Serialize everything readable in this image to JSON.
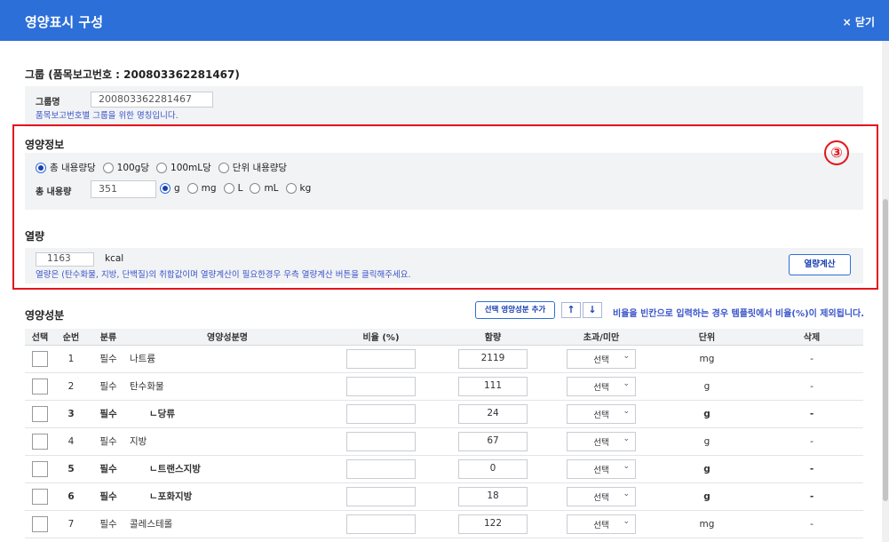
{
  "header": {
    "title": "영양표시 구성",
    "close_label": "닫기",
    "close_icon": "×"
  },
  "group": {
    "title": "그룹 (품목보고번호 : 200803362281467)",
    "name_label": "그룹명",
    "name_value": "200803362281467",
    "hint": "품목보고번호별 그룹을 위한 명칭입니다."
  },
  "nutrition_info": {
    "title": "영양정보",
    "badge": "③",
    "basis_options": [
      "총 내용량당",
      "100g당",
      "100mL당",
      "단위 내용량당"
    ],
    "basis_selected": "총 내용량당",
    "amount_label": "총 내용량",
    "amount_value": "351",
    "unit_options": [
      "g",
      "mg",
      "L",
      "mL",
      "kg"
    ],
    "unit_selected": "g"
  },
  "calories": {
    "title": "열량",
    "value": "1163",
    "unit": "kcal",
    "hint": "열량은 (탄수화물, 지방, 단백질)의 취합값이며 열량계산이 필요한경우 우측 열량계산 버튼을 클릭해주세요.",
    "calc_button": "열량계산"
  },
  "components": {
    "title": "영양성분",
    "add_button": "선택 영양성분 추가",
    "up_icon": "↑",
    "down_icon": "↓",
    "notice": "비율을 빈칸으로 입력하는 경우 템플릿에서 비율(%)이 제외됩니다.",
    "columns": [
      "선택",
      "순번",
      "분류",
      "영양성분명",
      "비율 (%)",
      "함량",
      "초과/미만",
      "단위",
      "삭제"
    ],
    "select_placeholder": "선택",
    "rows": [
      {
        "no": "1",
        "category": "필수",
        "name": "나트륨",
        "ratio": "",
        "amount": "2119",
        "unit": "mg",
        "delete": "-",
        "bold": false
      },
      {
        "no": "2",
        "category": "필수",
        "name": "탄수화물",
        "ratio": "",
        "amount": "111",
        "unit": "g",
        "delete": "-",
        "bold": false
      },
      {
        "no": "3",
        "category": "필수",
        "name": "ㄴ당류",
        "ratio": "",
        "amount": "24",
        "unit": "g",
        "delete": "-",
        "bold": true
      },
      {
        "no": "4",
        "category": "필수",
        "name": "지방",
        "ratio": "",
        "amount": "67",
        "unit": "g",
        "delete": "-",
        "bold": false
      },
      {
        "no": "5",
        "category": "필수",
        "name": "ㄴ트랜스지방",
        "ratio": "",
        "amount": "0",
        "unit": "g",
        "delete": "-",
        "bold": true
      },
      {
        "no": "6",
        "category": "필수",
        "name": "ㄴ포화지방",
        "ratio": "",
        "amount": "18",
        "unit": "g",
        "delete": "-",
        "bold": true
      },
      {
        "no": "7",
        "category": "필수",
        "name": "콜레스테롤",
        "ratio": "",
        "amount": "122",
        "unit": "mg",
        "delete": "-",
        "bold": false
      }
    ]
  }
}
